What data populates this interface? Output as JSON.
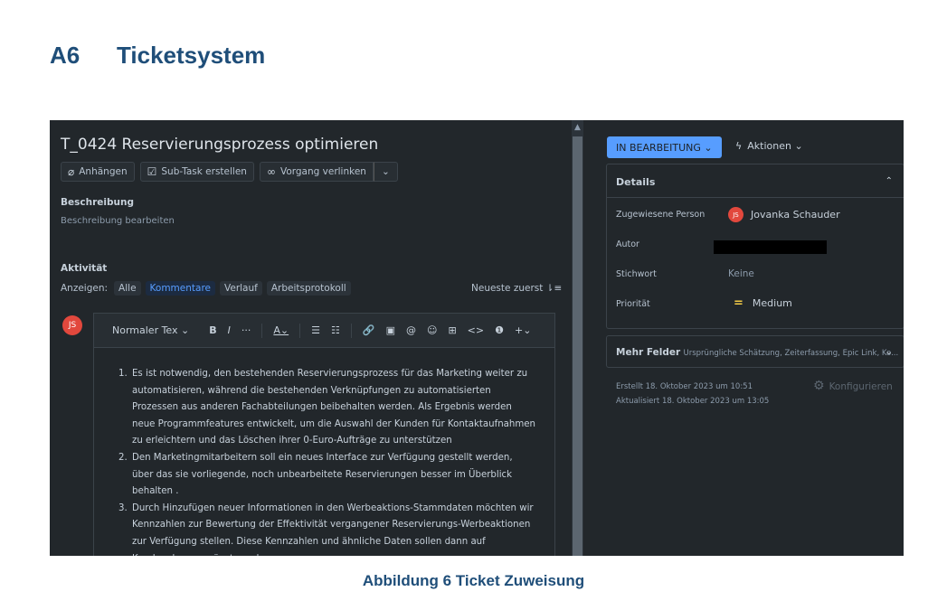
{
  "document": {
    "heading_number": "A6",
    "heading_text": "Ticketsystem",
    "caption": "Abbildung 6 Ticket Zuweisung"
  },
  "ticket": {
    "title": "T_0424 Reservierungsprozess optimieren",
    "buttons": {
      "attach": "Anhängen",
      "subtask": "Sub-Task erstellen",
      "link": "Vorgang verlinken",
      "more": "⌄"
    },
    "description_label": "Beschreibung",
    "description_placeholder": "Beschreibung bearbeiten",
    "activity_label": "Aktivität",
    "show_label": "Anzeigen:",
    "filters": [
      "Alle",
      "Kommentare",
      "Verlauf",
      "Arbeitsprotokoll"
    ],
    "active_filter": "Kommentare",
    "sort": "Neueste zuerst ⇂≡",
    "user_initials": "JS"
  },
  "editor": {
    "text_style": "Normaler Tex ⌄",
    "tools": [
      "B",
      "I",
      "···",
      "A⌄",
      "☰",
      "☷",
      "🔗",
      "▣",
      "@",
      "☺",
      "⊞",
      "<>",
      "❶",
      "+⌄"
    ],
    "items": [
      "Es ist notwendig, den bestehenden Reservierungsprozess für das Marketing weiter zu automatisieren, während die bestehenden Verknüpfungen zu automatisierten Prozessen aus anderen Fachabteilungen beibehalten werden. Als Ergebnis werden neue Programmfeatures entwickelt, um die Auswahl der Kunden für Kontaktaufnahmen zu erleichtern und das Löschen ihrer 0-Euro-Aufträge zu unterstützen",
      "Den Marketingmitarbeitern soll ein neues Interface zur Verfügung gestellt werden, über das sie vorliegende, noch unbearbeitete Reservierungen besser im Überblick behalten .",
      "Durch Hinzufügen neuer Informationen in den Werbeaktions-Stammdaten möchten wir Kennzahlen zur Bewertung der Effektivität vergangener Reservierungs-Werbeaktionen zur Verfügung stellen. Diese Kennzahlen und ähnliche Daten sollen dann auf Kundenebene ergänzt werden."
    ]
  },
  "sidebar": {
    "status": "IN BEARBEITUNG ⌄",
    "actions": "Aktionen ⌄",
    "details_title": "Details",
    "fields": [
      {
        "label": "Zugewiesene Person",
        "value": "Jovanka Schauder"
      },
      {
        "label": "Autor",
        "value": ""
      },
      {
        "label": "Stichwort",
        "value": "Keine"
      },
      {
        "label": "Priorität",
        "value": "Medium"
      }
    ],
    "assignee_initials": "JS",
    "more_fields_title": "Mehr Felder",
    "more_fields_list": "Ursprüngliche Schätzung, Zeiterfassung, Epic Link, Ko...",
    "created": "Erstellt 18. Oktober 2023 um 10:51",
    "updated": "Aktualisiert 18. Oktober 2023 um 13:05",
    "configure": "Konfigurieren"
  },
  "colors": {
    "heading": "#1f4e79",
    "background": "#22272b",
    "status": "#579dff",
    "avatar": "#e2483d"
  }
}
